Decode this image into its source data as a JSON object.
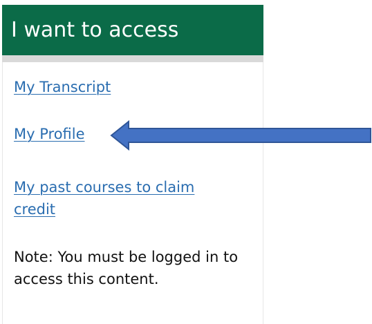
{
  "panel": {
    "header_title": "I want to access",
    "links": [
      {
        "label": "My Transcript"
      },
      {
        "label": "My Profile"
      },
      {
        "label": "My past courses to claim credit"
      }
    ],
    "note": "Note: You must be logged in to access this content."
  },
  "annotation": {
    "arrow_icon": "left-arrow-icon",
    "arrow_fill_color": "#4472C4",
    "arrow_stroke_color": "#2F5597"
  },
  "colors": {
    "header_background": "#0B6B48",
    "link_color": "#2A6DB0"
  }
}
